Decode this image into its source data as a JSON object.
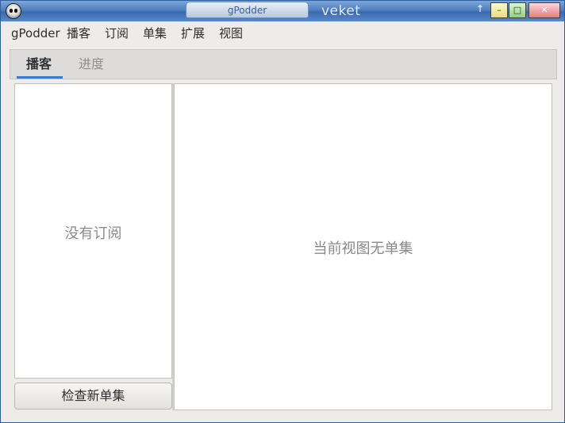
{
  "titlebar": {
    "title": "gPodder",
    "host": "veket",
    "minimize_glyph": "–",
    "maximize_glyph": "□",
    "close_glyph": "✕",
    "up_glyph": "↑"
  },
  "menu": {
    "items": [
      {
        "label": "gPodder"
      },
      {
        "label": "播客"
      },
      {
        "label": "订阅"
      },
      {
        "label": "单集"
      },
      {
        "label": "扩展"
      },
      {
        "label": "视图"
      }
    ]
  },
  "tabs": [
    {
      "label": "播客",
      "active": true
    },
    {
      "label": "进度",
      "active": false
    }
  ],
  "podcasts_pane": {
    "empty_text": "没有订阅",
    "check_button_label": "检查新单集"
  },
  "episodes_pane": {
    "empty_text": "当前视图无单集"
  },
  "colors": {
    "titlebar": "#4f7fc0",
    "tab_accent": "#3d7ad0",
    "window_bg": "#edeceb"
  }
}
